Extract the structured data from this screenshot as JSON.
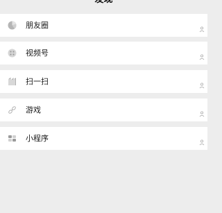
{
  "header": {
    "title": "发现"
  },
  "menu": {
    "items": [
      {
        "label": "朋友圈",
        "icon": "moments-icon"
      },
      {
        "label": "视频号",
        "icon": "channels-icon"
      },
      {
        "label": "扫一扫",
        "icon": "scan-icon"
      },
      {
        "label": "游戏",
        "icon": "game-icon"
      },
      {
        "label": "小程序",
        "icon": "mini-program-icon"
      }
    ]
  },
  "colors": {
    "background": "#ededed",
    "row": "#ffffff",
    "text": "#1a1a1a",
    "icon": "#9a9a9a"
  }
}
